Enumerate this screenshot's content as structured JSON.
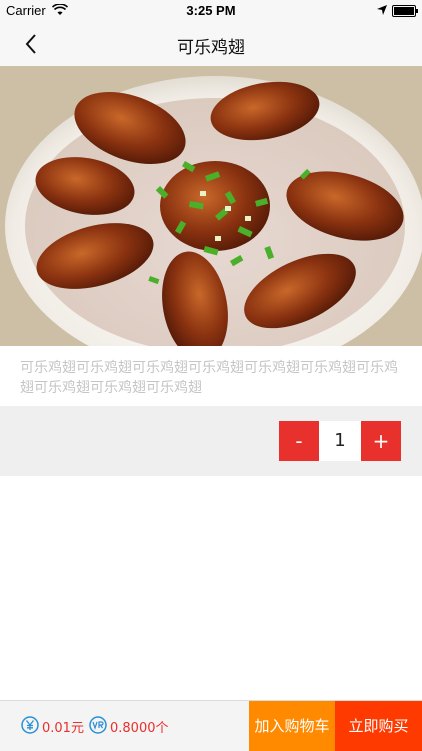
{
  "status": {
    "carrier": "Carrier",
    "time": "3:25 PM"
  },
  "nav": {
    "title": "可乐鸡翅"
  },
  "product": {
    "description": "可乐鸡翅可乐鸡翅可乐鸡翅可乐鸡翅可乐鸡翅可乐鸡翅可乐鸡翅可乐鸡翅可乐鸡翅可乐鸡翅"
  },
  "quantity": {
    "minus": "-",
    "value": "1",
    "plus": "+"
  },
  "bottom": {
    "price_rmb": "0.01元",
    "price_vr": "0.8000个",
    "add_to_cart": "加入购物车",
    "buy_now": "立即购买"
  },
  "colors": {
    "accent": "#e8302c",
    "cart": "#ff8a00",
    "buy": "#ff3a00"
  }
}
